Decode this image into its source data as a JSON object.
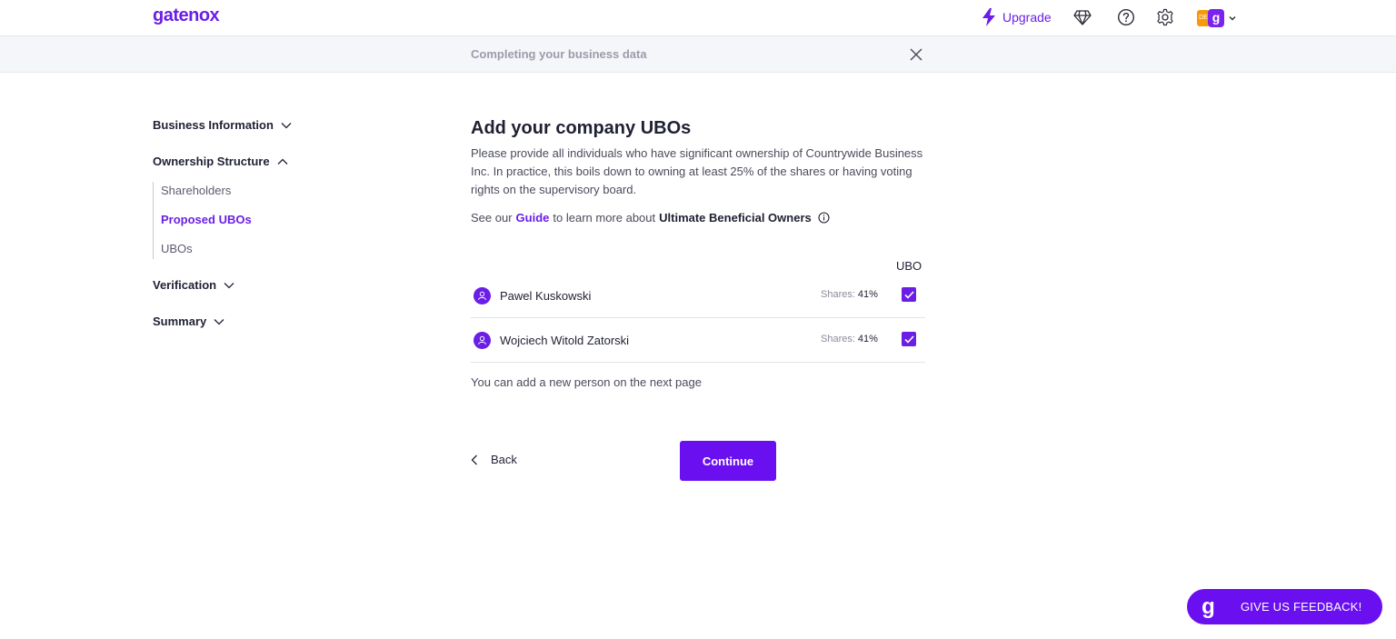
{
  "header": {
    "logo": "gatenox",
    "upgrade_label": "Upgrade",
    "avatar_letter": "g",
    "avatar_badge": "DE"
  },
  "subheader": {
    "title": "Completing your business data"
  },
  "sidebar": {
    "sections": [
      {
        "label": "Business Information",
        "expanded": false
      },
      {
        "label": "Ownership Structure",
        "expanded": true
      },
      {
        "label": "Verification",
        "expanded": false
      },
      {
        "label": "Summary",
        "expanded": false
      }
    ],
    "sub_items": [
      {
        "label": "Shareholders",
        "active": false
      },
      {
        "label": "Proposed UBOs",
        "active": true
      },
      {
        "label": "UBOs",
        "active": false
      }
    ]
  },
  "main": {
    "title": "Add your company UBOs",
    "description": "Please provide all individuals who have significant ownership of Countrywide Business Inc. In practice, this boils down to owning at least 25% of the shares or having voting rights on the supervisory board.",
    "guide_prefix": "See our",
    "guide_link": "Guide",
    "guide_middle": "to learn more about",
    "guide_bold": "Ultimate Beneficial Owners",
    "ubo_column": "UBO",
    "people": [
      {
        "name": "Pawel Kuskowski",
        "shares_label": "Shares:",
        "shares_value": "41%",
        "is_ubo": true
      },
      {
        "name": "Wojciech Witold Zatorski",
        "shares_label": "Shares:",
        "shares_value": "41%",
        "is_ubo": true
      }
    ],
    "note": "You can add a new person on the next page",
    "back_label": "Back",
    "continue_label": "Continue"
  },
  "feedback": {
    "icon_letter": "g",
    "label": "GIVE US FEEDBACK!"
  },
  "colors": {
    "accent": "#6a1ee6",
    "button": "#6a0ff0",
    "subheader_bg": "#f5f6fa"
  }
}
